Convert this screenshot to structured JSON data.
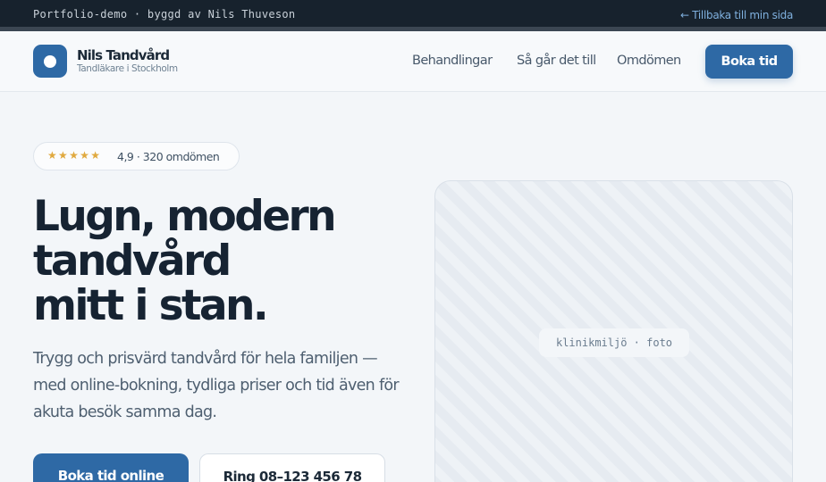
{
  "demo_bar": {
    "text": "Portfolio-demo · byggd av Nils Thuveson",
    "back_link": "← Tillbaka till min sida"
  },
  "header": {
    "brand_name": "Nils Tandvård",
    "brand_sub": "Tandläkare i Stockholm",
    "nav": [
      "Behandlingar",
      "Så går det till",
      "Omdömen"
    ],
    "cta": "Boka tid"
  },
  "rating": {
    "stars": "★★★★★",
    "stars_value": 5,
    "text": "4,9 · 320 omdömen",
    "star_color": "#e0a93e"
  },
  "hero": {
    "title_lines": [
      "Lugn, modern",
      "tandvård",
      "mitt i stan."
    ],
    "text": "Trygg och prisvärd tandvård för hela familjen — med online-bokning, tydliga priser och tid även för akuta besök samma dag.",
    "primary_button": "Boka tid online",
    "secondary_button": "Ring 08–123 456 78"
  },
  "photo": {
    "label": "klinikmiljö · foto"
  },
  "colors": {
    "accent": "#2e69a5",
    "dark_bar": "#17222d",
    "background": "#f3f6f9"
  }
}
